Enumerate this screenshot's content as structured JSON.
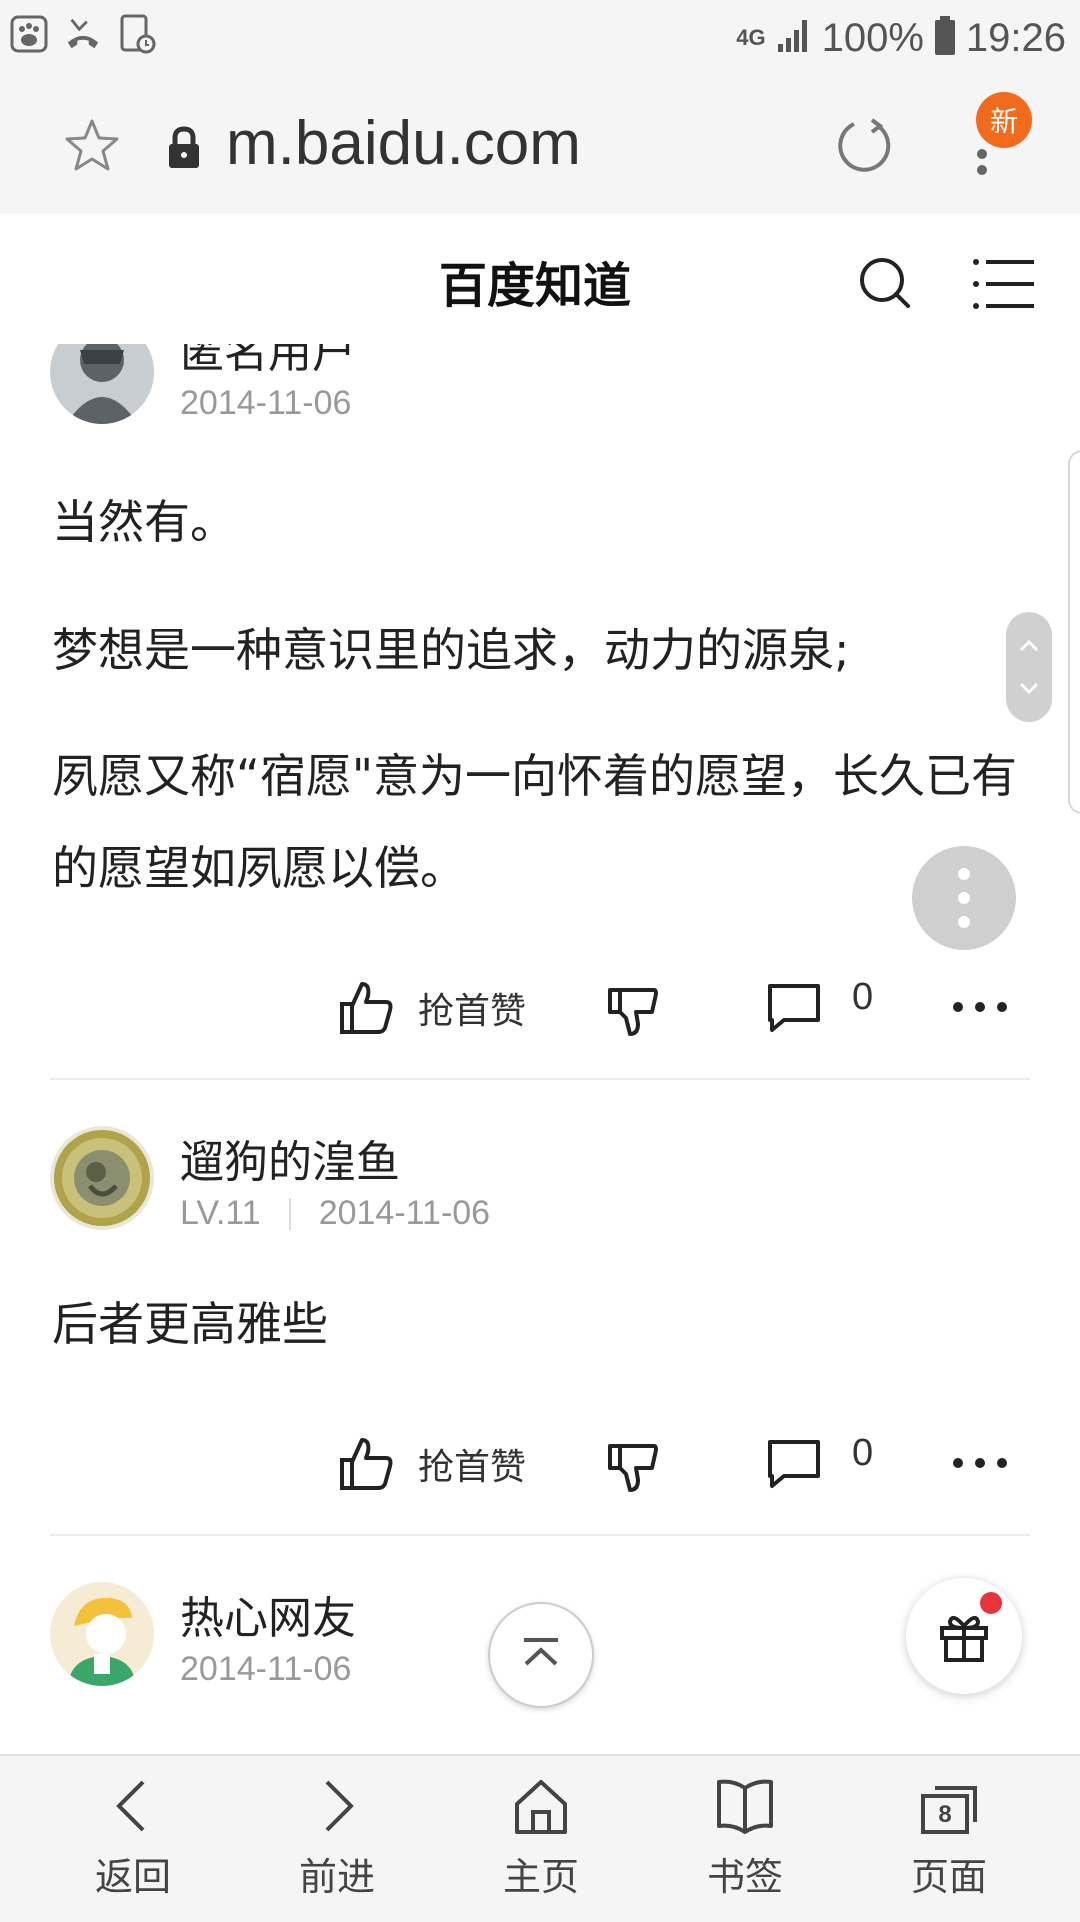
{
  "status_bar": {
    "network": "4G",
    "battery": "100%",
    "time": "19:26"
  },
  "browser": {
    "url": "m.baidu.com",
    "new_badge": "新"
  },
  "header": {
    "title": "百度知道"
  },
  "answers": [
    {
      "user": "匿名用户",
      "level": "",
      "date": "2014-11-06",
      "paragraphs": [
        "当然有。",
        "梦想是一种意识里的追求，动力的源泉;",
        "夙愿又称“宿愿\"意为一向怀着的愿望，长久已有的愿望如夙愿以偿。"
      ],
      "like_label": "抢首赞",
      "comment_count": "0"
    },
    {
      "user": "遛狗的湟鱼",
      "level": "LV.11",
      "date": "2014-11-06",
      "paragraphs": [
        "后者更高雅些"
      ],
      "like_label": "抢首赞",
      "comment_count": "0"
    },
    {
      "user": "热心网友",
      "level": "",
      "date": "2014-11-06"
    }
  ],
  "bottom_nav": {
    "back": "返回",
    "forward": "前进",
    "home": "主页",
    "bookmarks": "书签",
    "pages": "页面",
    "pages_count": "8"
  },
  "colors": {
    "badge": "#f26b1d",
    "gift_dot": "#e8343a",
    "bar_bg": "#f5f5f5"
  }
}
